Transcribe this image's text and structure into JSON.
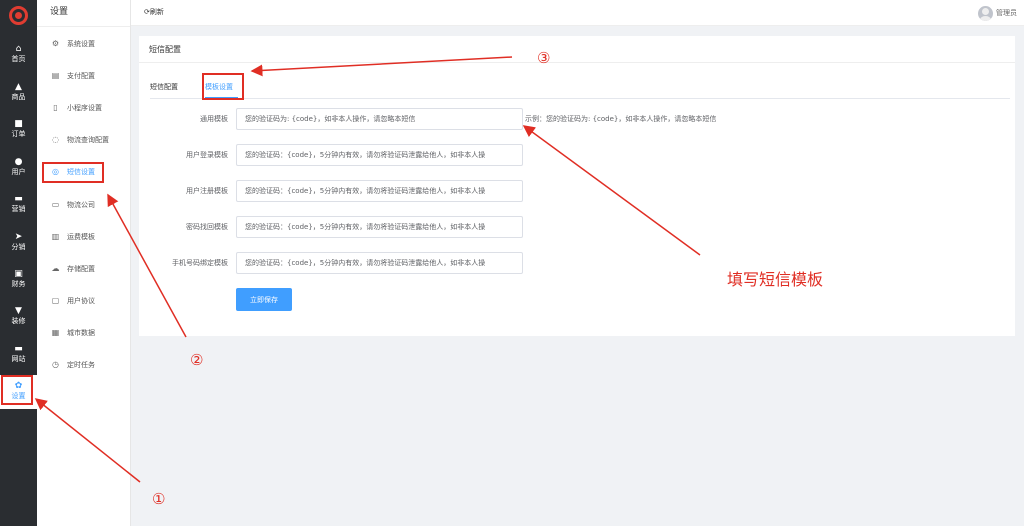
{
  "rail": {
    "items": [
      {
        "label": "首页",
        "icon": "home-icon",
        "glyph": "⌂"
      },
      {
        "label": "商品",
        "icon": "bag-icon",
        "glyph": "▲"
      },
      {
        "label": "订单",
        "icon": "order-icon",
        "glyph": "■"
      },
      {
        "label": "用户",
        "icon": "user-icon",
        "glyph": "●"
      },
      {
        "label": "营销",
        "icon": "marketing-icon",
        "glyph": "▬"
      },
      {
        "label": "分销",
        "icon": "share-icon",
        "glyph": "➤"
      },
      {
        "label": "财务",
        "icon": "finance-icon",
        "glyph": "▣"
      },
      {
        "label": "装修",
        "icon": "brush-icon",
        "glyph": "▼"
      },
      {
        "label": "网站",
        "icon": "website-icon",
        "glyph": "▬"
      },
      {
        "label": "设置",
        "icon": "gear-icon",
        "glyph": "✿"
      }
    ]
  },
  "menu": {
    "title": "设置",
    "items": [
      {
        "label": "系统设置",
        "icon": "gear-outline-icon",
        "glyph": "⚙"
      },
      {
        "label": "支付配置",
        "icon": "wallet-icon",
        "glyph": "▤"
      },
      {
        "label": "小程序设置",
        "icon": "miniapp-icon",
        "glyph": "▯"
      },
      {
        "label": "物流查询配置",
        "icon": "truck-search-icon",
        "glyph": "◌"
      },
      {
        "label": "短信设置",
        "icon": "message-icon",
        "glyph": "◎"
      },
      {
        "label": "物流公司",
        "icon": "truck-icon",
        "glyph": "▭"
      },
      {
        "label": "运费模板",
        "icon": "template-icon",
        "glyph": "▥"
      },
      {
        "label": "存储配置",
        "icon": "cloud-icon",
        "glyph": "☁"
      },
      {
        "label": "用户协议",
        "icon": "document-icon",
        "glyph": "▢"
      },
      {
        "label": "城市数据",
        "icon": "building-icon",
        "glyph": "▦"
      },
      {
        "label": "定时任务",
        "icon": "clock-icon",
        "glyph": "◷"
      }
    ]
  },
  "topbar": {
    "refresh": "⟳刷新",
    "user": "管理员"
  },
  "card": {
    "title": "短信配置",
    "tabs": [
      "短信配置",
      "模板设置"
    ],
    "rows": [
      {
        "label": "通用模板",
        "value": "您的验证码为: {code}，如非本人操作，请忽略本短信",
        "hint": "示例：您的验证码为: {code}，如非本人操作，请忽略本短信"
      },
      {
        "label": "用户登录模板",
        "value": "您的验证码：{code}，5分钟内有效，请勿将验证码泄露给他人，如非本人操",
        "hint": ""
      },
      {
        "label": "用户注册模板",
        "value": "您的验证码：{code}，5分钟内有效，请勿将验证码泄露给他人，如非本人操",
        "hint": ""
      },
      {
        "label": "密码找回模板",
        "value": "您的验证码：{code}，5分钟内有效，请勿将验证码泄露给他人，如非本人操",
        "hint": ""
      },
      {
        "label": "手机号码绑定模板",
        "value": "您的验证码：{code}，5分钟内有效，请勿将验证码泄露给他人，如非本人操",
        "hint": ""
      }
    ],
    "save": "立即保存"
  },
  "annotations": {
    "n1": "①",
    "n2": "②",
    "n3": "③",
    "callout": "填写短信模板",
    "color": "#e02e24"
  }
}
